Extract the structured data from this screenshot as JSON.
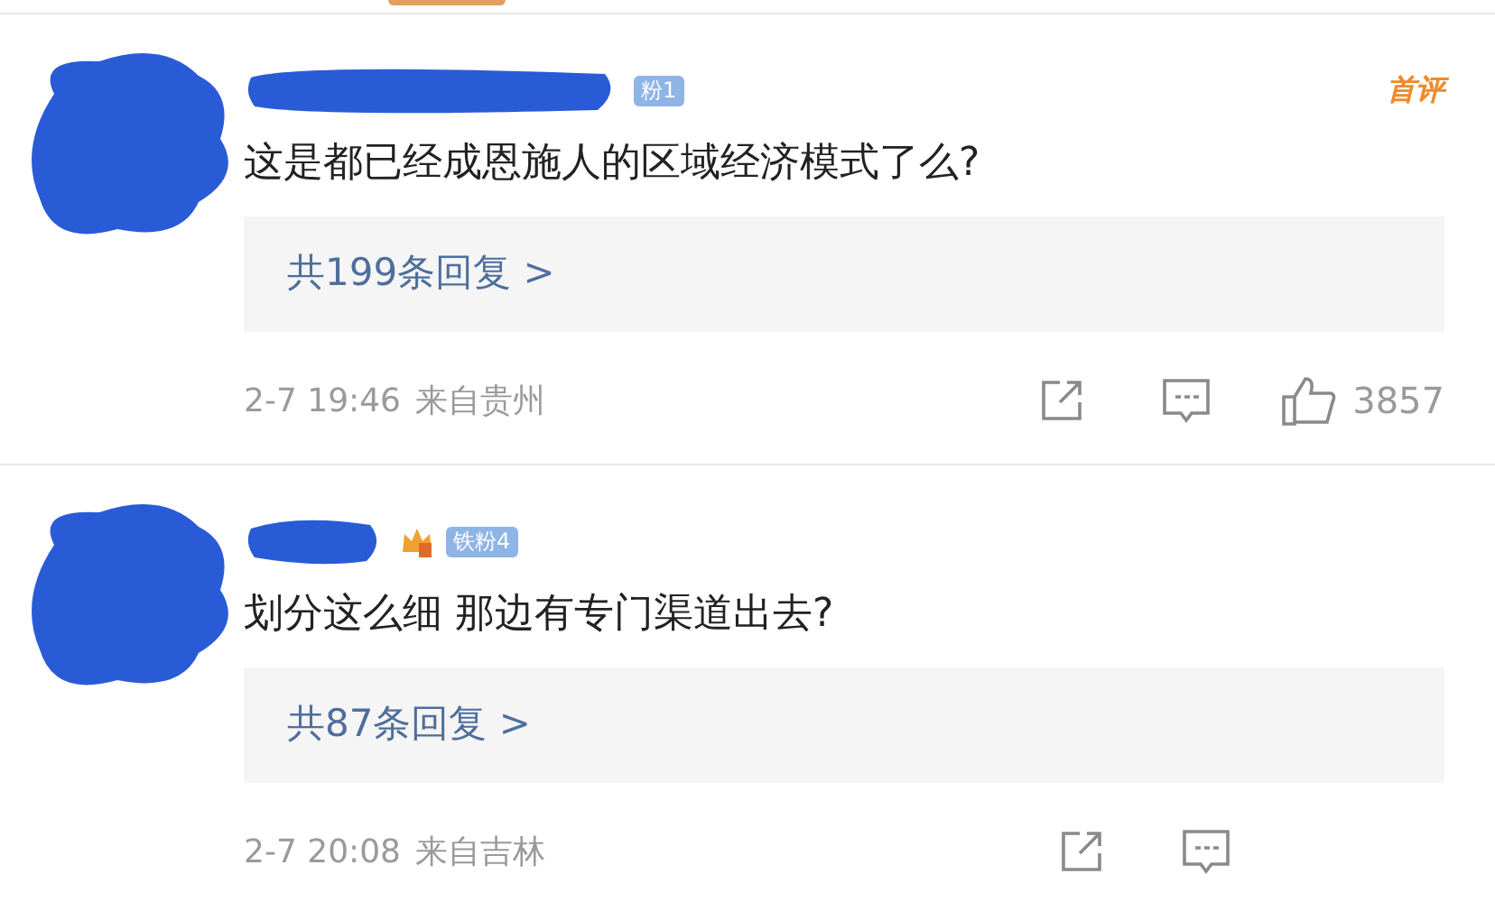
{
  "comments": [
    {
      "badge": {
        "text": "粉1",
        "crown": false
      },
      "tag": "首评",
      "text": "这是都已经成恩施人的区域经济模式了么?",
      "replies": "共199条回复 >",
      "time": "2-7 19:46",
      "location": "来自贵州",
      "like_count": "3857"
    },
    {
      "badge": {
        "text": "铁粉4",
        "crown": true
      },
      "text": "划分这么细 那边有专门渠道出去?",
      "replies": "共87条回复 >",
      "time": "2-7 20:08",
      "location": "来自吉林"
    }
  ]
}
